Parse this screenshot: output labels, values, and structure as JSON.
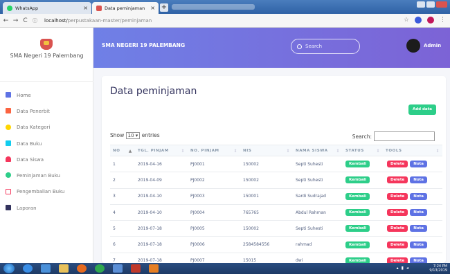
{
  "browser": {
    "tabs": [
      {
        "title": "WhatsApp",
        "active": false
      },
      {
        "title": "Data peminjaman",
        "active": true
      }
    ],
    "url_host": "localhost/",
    "url_path": "perpustakaan-master/peminjaman"
  },
  "sidebar": {
    "school_name": "SMA Negeri 19 Palembang",
    "items": [
      {
        "label": "Home",
        "icon": "monitor-icon",
        "color": "#5e72e4"
      },
      {
        "label": "Data Penerbit",
        "icon": "book-icon",
        "color": "#fb6340"
      },
      {
        "label": "Data Kategori",
        "icon": "circle-icon",
        "color": "#ffd600"
      },
      {
        "label": "Data Buku",
        "icon": "list-icon",
        "color": "#11cdef"
      },
      {
        "label": "Data Siswa",
        "icon": "user-icon",
        "color": "#f5365c"
      },
      {
        "label": "Peminjaman Buku",
        "icon": "share-icon",
        "color": "#2dce89"
      },
      {
        "label": "Pengembalian Buku",
        "icon": "calendar-icon",
        "color": "#f5365c"
      },
      {
        "label": "Laporan",
        "icon": "briefcase-icon",
        "color": "#32325d"
      }
    ]
  },
  "header": {
    "title": "SMA NEGERI 19 PALEMBANG",
    "search_placeholder": "Search",
    "user": "Admin"
  },
  "page": {
    "heading": "Data peminjaman",
    "add_button": "Add data",
    "show_label": "Show",
    "entries_value": "10",
    "entries_label": "entries",
    "search_label": "Search:"
  },
  "table": {
    "columns": [
      "NO",
      "TGL. PINJAM",
      "NO. PINJAM",
      "NIS",
      "NAMA SISWA",
      "STATUS",
      "TOOLS"
    ],
    "rows": [
      [
        "1",
        "2019-04-16",
        "PJ0001",
        "150002",
        "Septi Suhesti"
      ],
      [
        "2",
        "2019-04-09",
        "PJ0002",
        "150002",
        "Septi Suhesti"
      ],
      [
        "3",
        "2019-04-10",
        "PJ0003",
        "150001",
        "Sardi Sudrajad"
      ],
      [
        "4",
        "2019-04-10",
        "PJ0004",
        "765765",
        "Abdul Rahman"
      ],
      [
        "5",
        "2019-07-18",
        "PJ0005",
        "150002",
        "Septi Suhesti"
      ],
      [
        "6",
        "2019-07-18",
        "PJ0006",
        "2584584556",
        "rahmad"
      ],
      [
        "7",
        "2019-07-18",
        "PJ0007",
        "15015",
        "dwi"
      ]
    ],
    "status_label": "Kembali",
    "delete_label": "Delete",
    "nota_label": "Nota"
  },
  "taskbar": {
    "time": "7:24 PM",
    "date": "9/13/2019"
  },
  "colors": {
    "accent": "#5e72e4",
    "success": "#2dce89",
    "danger": "#f5365c"
  }
}
